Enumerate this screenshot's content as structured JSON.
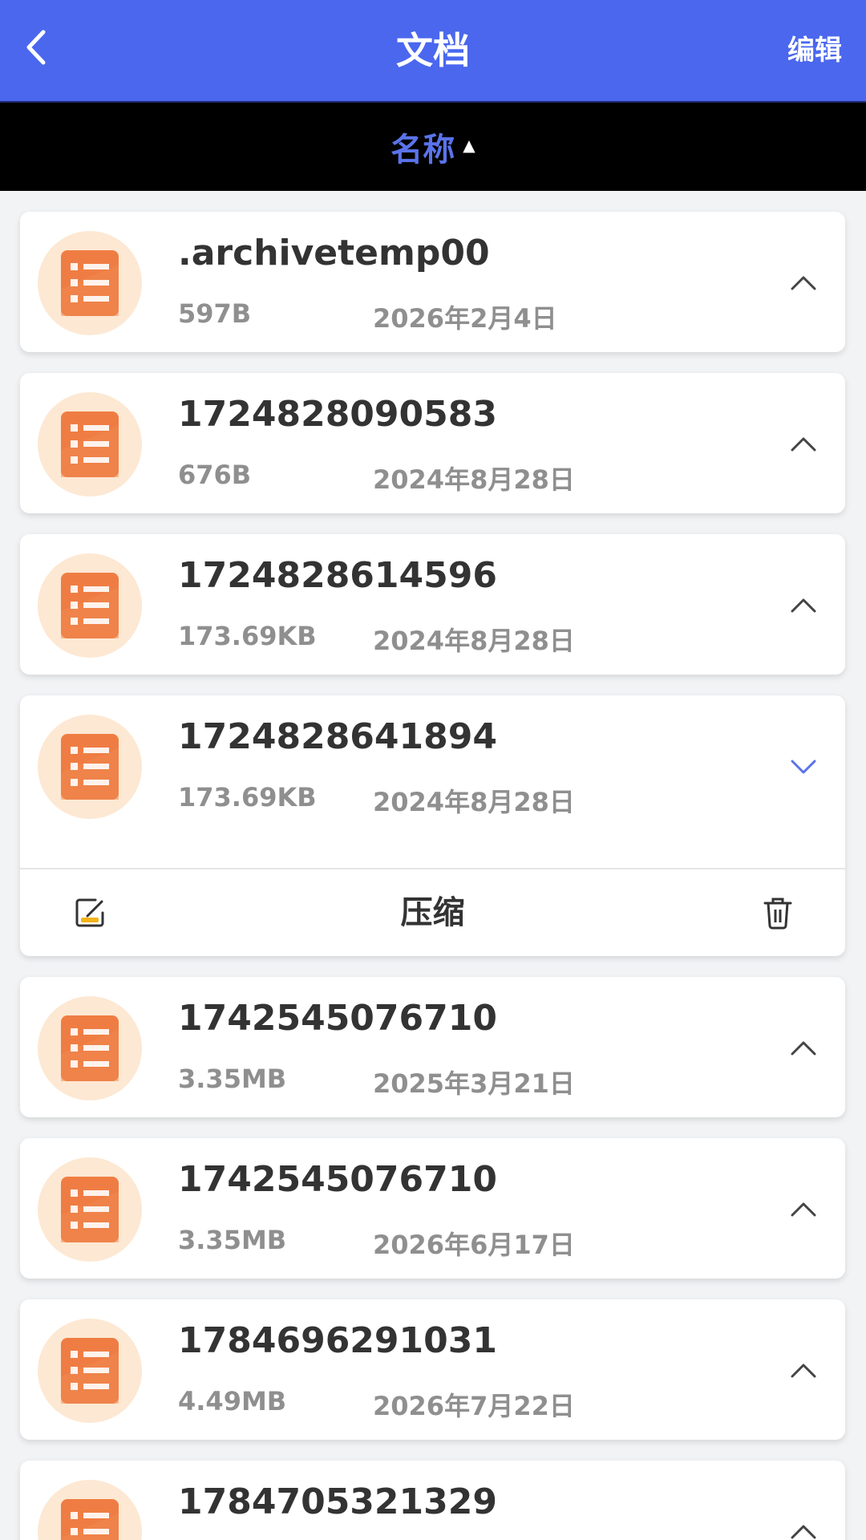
{
  "header": {
    "back_icon": "chevron-left-icon",
    "title": "文档",
    "edit_label": "编辑"
  },
  "sortbar": {
    "label": "名称",
    "arrow": "▲"
  },
  "files": [
    {
      "name": ".archivetemp00",
      "size": "597B",
      "date": "2026年2月4日",
      "expanded": false
    },
    {
      "name": "1724828090583",
      "size": "676B",
      "date": "2024年8月28日",
      "expanded": false
    },
    {
      "name": "1724828614596",
      "size": "173.69KB",
      "date": "2024年8月28日",
      "expanded": false
    },
    {
      "name": "1724828641894",
      "size": "173.69KB",
      "date": "2024年8月28日",
      "expanded": true
    },
    {
      "name": "1742545076710",
      "size": "3.35MB",
      "date": "2025年3月21日",
      "expanded": false
    },
    {
      "name": "1742545076710",
      "size": "3.35MB",
      "date": "2026年6月17日",
      "expanded": false
    },
    {
      "name": "1784696291031",
      "size": "4.49MB",
      "date": "2026年7月22日",
      "expanded": false
    },
    {
      "name": "1784705321329",
      "size": "",
      "date": "",
      "expanded": false
    }
  ],
  "expanded_actions": {
    "rename_icon": "edit-icon",
    "compress_label": "压缩",
    "delete_icon": "trash-icon"
  },
  "colors": {
    "header_bg": "#4a67ee",
    "sort_label": "#5a73ea",
    "icon_circle": "#fde8d3",
    "icon_orange": "#ef7d43",
    "chevron_active": "#5a73ea"
  }
}
